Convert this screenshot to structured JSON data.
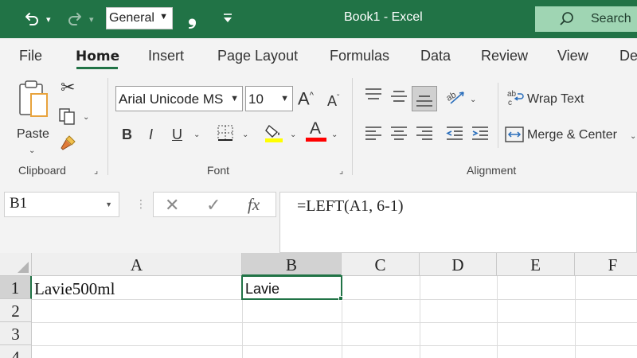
{
  "titlebar": {
    "number_format": "General",
    "title": "Book1  -  Excel",
    "search_label": "Search"
  },
  "tabs": [
    "File",
    "Home",
    "Insert",
    "Page Layout",
    "Formulas",
    "Data",
    "Review",
    "View",
    "De"
  ],
  "ribbon": {
    "clipboard": {
      "paste_label": "Paste",
      "group_label": "Clipboard"
    },
    "font": {
      "font_name": "Arial Unicode MS",
      "font_size": "10",
      "bold": "B",
      "italic": "I",
      "underline": "U",
      "grow": "A",
      "shrink": "A",
      "font_color": "A",
      "group_label": "Font"
    },
    "alignment": {
      "wrap_text": "Wrap Text",
      "merge_center": "Merge & Center",
      "group_label": "Alignment"
    },
    "colors": {
      "fill_color": "#ffff00",
      "font_color": "#ff0000"
    }
  },
  "formula_bar": {
    "name_box": "B1",
    "cancel": "✕",
    "enter": "✓",
    "fx": "fx",
    "formula": "=LEFT(A1, 6-1)"
  },
  "grid": {
    "columns": [
      "A",
      "B",
      "C",
      "D",
      "E",
      "F"
    ],
    "rows": [
      "1",
      "2",
      "3",
      "4"
    ],
    "cells": {
      "A1": "Lavie500ml",
      "B1": "Lavie"
    },
    "selected_cell": "B1"
  },
  "colors": {
    "accent": "#217346"
  }
}
